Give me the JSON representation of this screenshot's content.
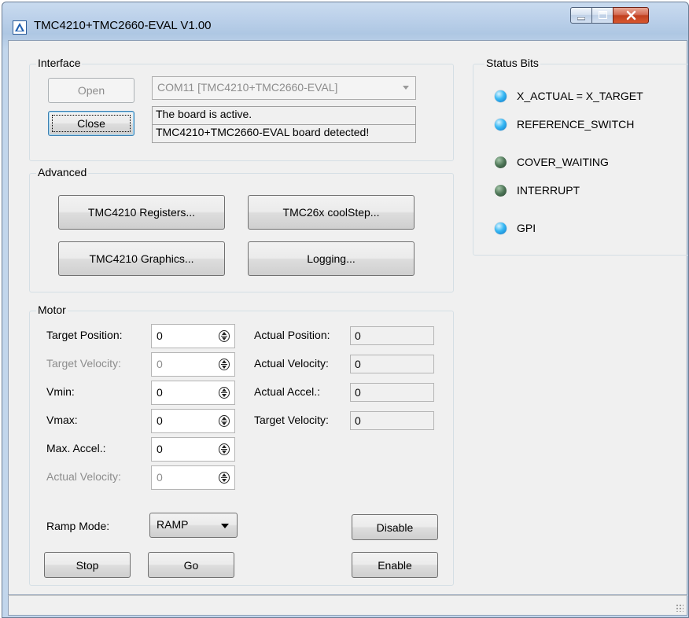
{
  "window": {
    "title": "TMC4210+TMC2660-EVAL V1.00"
  },
  "interface": {
    "legend": "Interface",
    "open_label": "Open",
    "close_label": "Close",
    "port_value": "COM11  [TMC4210+TMC2660-EVAL]",
    "status_line1": "The board is active.",
    "status_line2": "TMC4210+TMC2660-EVAL board detected!"
  },
  "advanced": {
    "legend": "Advanced",
    "registers_label": "TMC4210 Registers...",
    "coolstep_label": "TMC26x coolStep...",
    "graphics_label": "TMC4210 Graphics...",
    "logging_label": "Logging..."
  },
  "motor": {
    "legend": "Motor",
    "inputs": [
      {
        "label": "Target Position:",
        "value": "0",
        "enabled": true
      },
      {
        "label": "Target Velocity:",
        "value": "0",
        "enabled": false
      },
      {
        "label": "Vmin:",
        "value": "0",
        "enabled": true
      },
      {
        "label": "Vmax:",
        "value": "0",
        "enabled": true
      },
      {
        "label": "Max. Accel.:",
        "value": "0",
        "enabled": true
      },
      {
        "label": "Actual Velocity:",
        "value": "0",
        "enabled": false
      }
    ],
    "readouts": [
      {
        "label": "Actual Position:",
        "value": "0"
      },
      {
        "label": "Actual Velocity:",
        "value": "0"
      },
      {
        "label": "Actual Accel.:",
        "value": "0"
      },
      {
        "label": "Target Velocity:",
        "value": "0"
      }
    ],
    "ramp_mode_label": "Ramp Mode:",
    "ramp_mode_value": "RAMP",
    "disable_label": "Disable",
    "enable_label": "Enable",
    "stop_label": "Stop",
    "go_label": "Go"
  },
  "status_bits": {
    "legend": "Status Bits",
    "items": [
      {
        "label": "X_ACTUAL = X_TARGET",
        "state": "on"
      },
      {
        "label": "REFERENCE_SWITCH",
        "state": "on"
      },
      {
        "label": "COVER_WAITING",
        "state": "off"
      },
      {
        "label": "INTERRUPT",
        "state": "off"
      },
      {
        "label": "GPI",
        "state": "on"
      }
    ]
  },
  "colors": {
    "led_on": "#37b8f4",
    "led_off": "#4d7556",
    "close_button": "#c0401f"
  }
}
